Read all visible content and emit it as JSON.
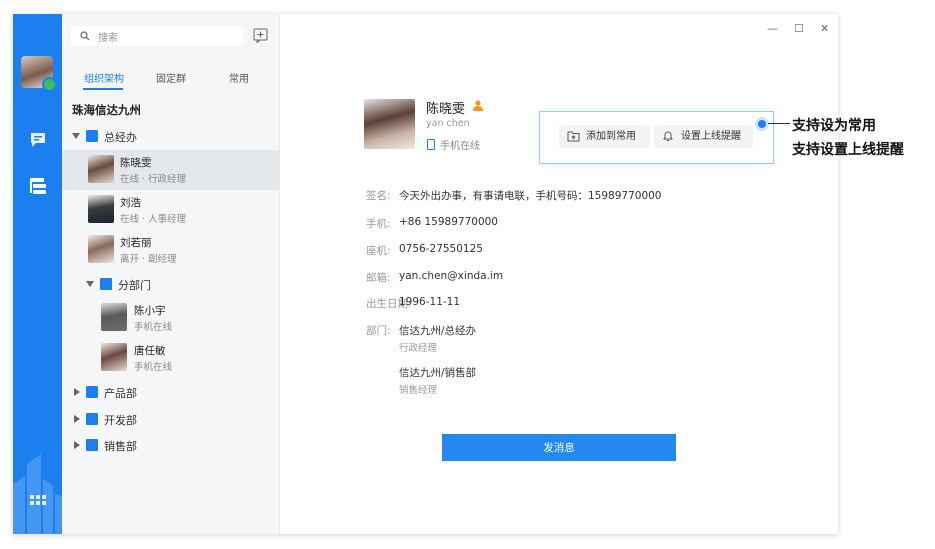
{
  "sidebar": {
    "search_placeholder": "搜索",
    "tabs": [
      "组织架构",
      "固定群",
      "常用"
    ],
    "org_name": "珠海信达九州",
    "departments": {
      "top": "总经办",
      "sub": "分部门",
      "product": "产品部",
      "dev": "开发部",
      "sales": "销售部"
    },
    "members": [
      {
        "name": "陈晓雯",
        "status": "在线 · 行政经理"
      },
      {
        "name": "刘浩",
        "status": "在线 · 人事经理"
      },
      {
        "name": "刘若丽",
        "status": "离开 · 副经理"
      },
      {
        "name": "陈小宇",
        "status": "手机在线"
      },
      {
        "name": "唐任敏",
        "status": "手机在线"
      }
    ]
  },
  "window_controls": {
    "minimize": "—",
    "maximize": "☐",
    "close": "✕"
  },
  "profile": {
    "name": "陈晓雯",
    "pinyin": "yan chen",
    "status": "手机在线",
    "fields": {
      "signature_label": "签名:",
      "signature_value": "今天外出办事，有事请电联，手机号码：15989770000",
      "mobile_label": "手机:",
      "mobile_value": "+86 15989770000",
      "landline_label": "座机:",
      "landline_value": "0756-27550125",
      "email_label": "邮箱:",
      "email_value": "yan.chen@xinda.im",
      "birthday_label": "出生日期:",
      "birthday_value": "1996-11-11",
      "dept_label": "部门:",
      "dept1": "信达九州/总经办",
      "dept1_role": "行政经理",
      "dept2": "信达九州/销售部",
      "dept2_role": "销售经理"
    },
    "send_button": "发消息"
  },
  "popup": {
    "add_favorite": "添加到常用",
    "online_alert": "设置上线提醒"
  },
  "callout": {
    "line1": "支持设为常用",
    "line2": "支持设置上线提醒"
  },
  "colors": {
    "accent": "#1b7ff0",
    "rail": "#1b7ff0",
    "online": "#3bbf5a",
    "user_icon": "#f39c12"
  }
}
